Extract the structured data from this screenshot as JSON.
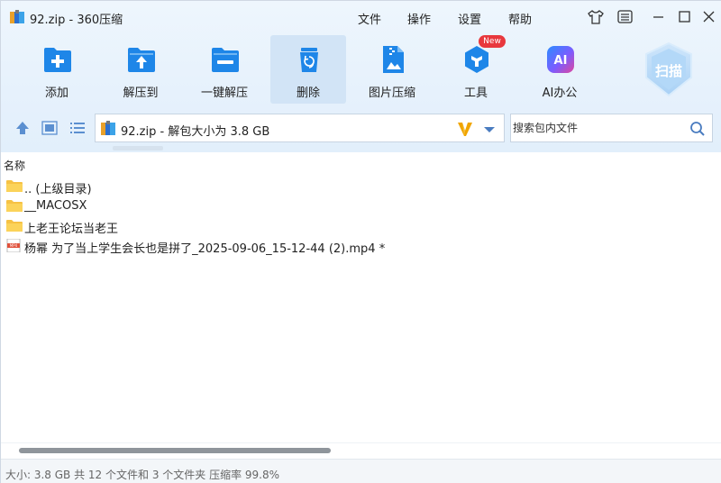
{
  "window": {
    "title": "92.zip - 360压缩"
  },
  "menu": {
    "file": "文件",
    "operation": "操作",
    "settings": "设置",
    "help": "帮助"
  },
  "toolbar": [
    {
      "label": "添加",
      "icon": "add-icon"
    },
    {
      "label": "解压到",
      "icon": "extract-to-icon"
    },
    {
      "label": "一键解压",
      "icon": "one-click-extract-icon"
    },
    {
      "label": "删除",
      "icon": "delete-icon",
      "active": true
    },
    {
      "label": "图片压缩",
      "icon": "image-compress-icon"
    },
    {
      "label": "工具",
      "icon": "tools-icon",
      "badge": "New"
    },
    {
      "label": "AI办公",
      "icon": "ai-office-icon"
    }
  ],
  "scan": {
    "label": "扫描"
  },
  "address": {
    "path": "92.zip - 解包大小为 3.8 GB"
  },
  "search": {
    "placeholder": "搜索包内文件"
  },
  "list": {
    "column_name": "名称",
    "items": [
      {
        "name": ".. (上级目录)",
        "type": "folder"
      },
      {
        "name": "__MACOSX",
        "type": "folder"
      },
      {
        "name": "上老王论坛当老王",
        "type": "folder"
      },
      {
        "name": "杨幂 为了当上学生会长也是拼了_2025-09-06_15-12-44 (2).mp4 *",
        "type": "video"
      }
    ]
  },
  "status": {
    "text": "大小: 3.8 GB 共 12 个文件和 3 个文件夹 压缩率 99.8%"
  },
  "colors": {
    "accent": "#1e7fe0",
    "toolbar_bg": "#e6f1fc",
    "active_tool": "#d2e4f6",
    "badge": "#e8383d"
  }
}
